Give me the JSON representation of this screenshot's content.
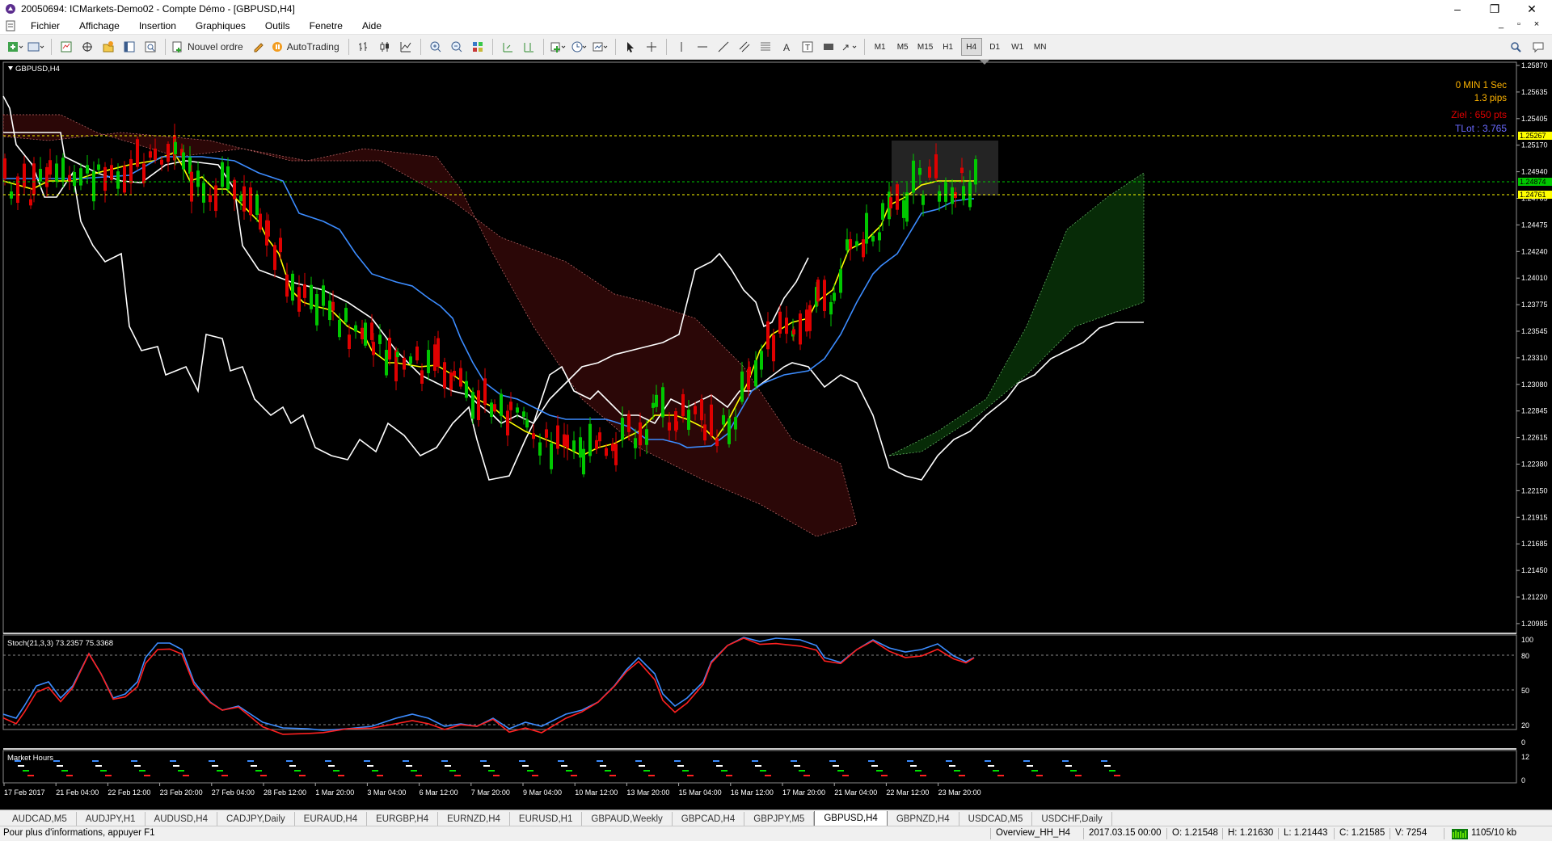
{
  "window": {
    "title": "20050694: ICMarkets-Demo02 - Compte Démo - [GBPUSD,H4]",
    "minimize": "–",
    "maximize": "❐",
    "close": "✕"
  },
  "menu": [
    "Fichier",
    "Affichage",
    "Insertion",
    "Graphiques",
    "Outils",
    "Fenetre",
    "Aide"
  ],
  "toolbar": {
    "new_order_label": "Nouvel ordre",
    "autotrading_label": "AutoTrading",
    "timeframes": [
      "M1",
      "M5",
      "M15",
      "H1",
      "H4",
      "D1",
      "W1",
      "MN"
    ],
    "active_timeframe": "H4"
  },
  "chart": {
    "symbol_label": "GBPUSD,H4",
    "info": {
      "timer": "0 MIN 1 Sec",
      "spread": "1.3 pips",
      "ziel": "Ziel : 650 pts",
      "tlot": "TLot : 3.765"
    },
    "price_labels": [
      "1.25870",
      "1.25635",
      "1.25405",
      "1.25170",
      "1.24940",
      "1.24705",
      "1.24475",
      "1.24240",
      "1.24010",
      "1.23775",
      "1.23545",
      "1.23310",
      "1.23080",
      "1.22845",
      "1.22615",
      "1.22380",
      "1.22150",
      "1.21915",
      "1.21685",
      "1.21450",
      "1.21220",
      "1.20985"
    ],
    "tag_upper": "1.25267",
    "tag_mid": "1.24874",
    "tag_lower": "1.24761",
    "colors": {
      "bull": "#00c800",
      "bear": "#e00000",
      "tenkan": "#ffff00",
      "kijun": "#3c8cff",
      "chikou": "#ffffff",
      "tag_yellow": "#ffff00",
      "tag_green": "#00c800"
    }
  },
  "stoch": {
    "label": "Stoch(21,3,3) 73.2357 75.3368",
    "levels": [
      "100",
      "80",
      "50",
      "20",
      "0"
    ],
    "colors": {
      "main": "#3c8cff",
      "signal": "#ff2020"
    }
  },
  "market_hours": {
    "label": "Market Hours",
    "levels": [
      "12",
      "0"
    ]
  },
  "time_labels": [
    "17 Feb 2017",
    "21 Feb 04:00",
    "22 Feb 12:00",
    "23 Feb 20:00",
    "27 Feb 04:00",
    "28 Feb 12:00",
    "1 Mar 20:00",
    "3 Mar 04:00",
    "6 Mar 12:00",
    "7 Mar 20:00",
    "9 Mar 04:00",
    "10 Mar 12:00",
    "13 Mar 20:00",
    "15 Mar 04:00",
    "16 Mar 12:00",
    "17 Mar 20:00",
    "21 Mar 04:00",
    "22 Mar 12:00",
    "23 Mar 20:00"
  ],
  "tabs": [
    "AUDCAD,M5",
    "AUDJPY,H1",
    "AUDUSD,H4",
    "CADJPY,Daily",
    "EURAUD,H4",
    "EURGBP,H4",
    "EURNZD,H4",
    "EURUSD,H1",
    "GBPAUD,Weekly",
    "GBPCAD,H4",
    "GBPJPY,M5",
    "GBPUSD,H4",
    "GBPNZD,H4",
    "USDCAD,M5",
    "USDCHF,Daily"
  ],
  "active_tab": "GBPUSD,H4",
  "status": {
    "help": "Pour plus d'informations, appuyer F1",
    "profile": "Overview_HH_H4",
    "datetime": "2017.03.15 00:00",
    "open": "O: 1.21548",
    "high": "H: 1.21630",
    "low": "L: 1.21443",
    "close": "C: 1.21585",
    "volume": "V: 7254",
    "traffic": "1105/10 kb"
  }
}
